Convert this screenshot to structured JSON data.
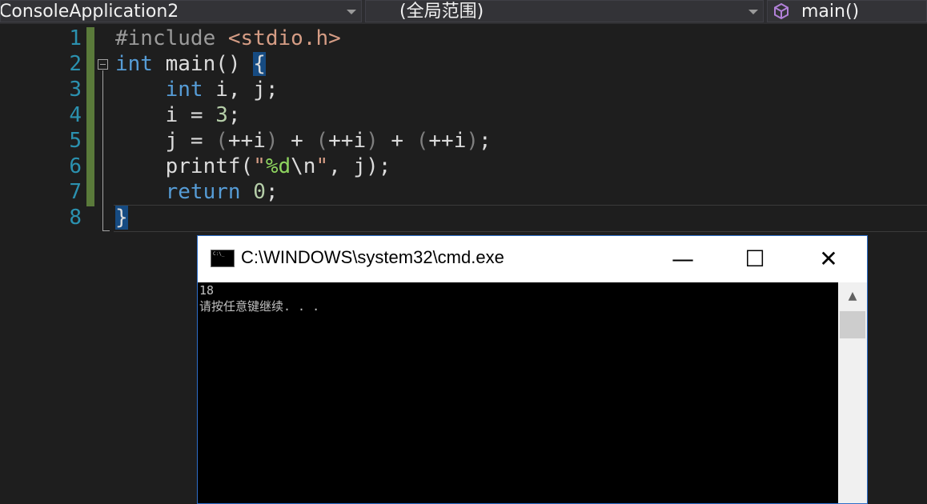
{
  "nav": {
    "project": "ConsoleApplication2",
    "scope": "(全局范围)",
    "member": "main()",
    "member_icon": "cube-icon"
  },
  "editor": {
    "line_numbers": [
      "1",
      "2",
      "3",
      "4",
      "5",
      "6",
      "7",
      "8"
    ]
  },
  "console_window": {
    "title": "C:\\WINDOWS\\system32\\cmd.exe",
    "icon": "cmd-icon",
    "icon_text": "C:\\_",
    "minimize_label": "—",
    "maximize_label": "☐",
    "close_label": "✕",
    "output_lines": [
      "18",
      "请按任意键继续. . ."
    ],
    "scroll_up_label": "▲"
  },
  "colors": {
    "editor_bg": "#1e1e1e",
    "keyword": "#569cd6",
    "line_number": "#2b91af",
    "string": "#d69d85",
    "number": "#b5cea8",
    "change_bar": "#5a7a3a",
    "console_bg": "#000000",
    "window_border": "#2d6ec9"
  }
}
